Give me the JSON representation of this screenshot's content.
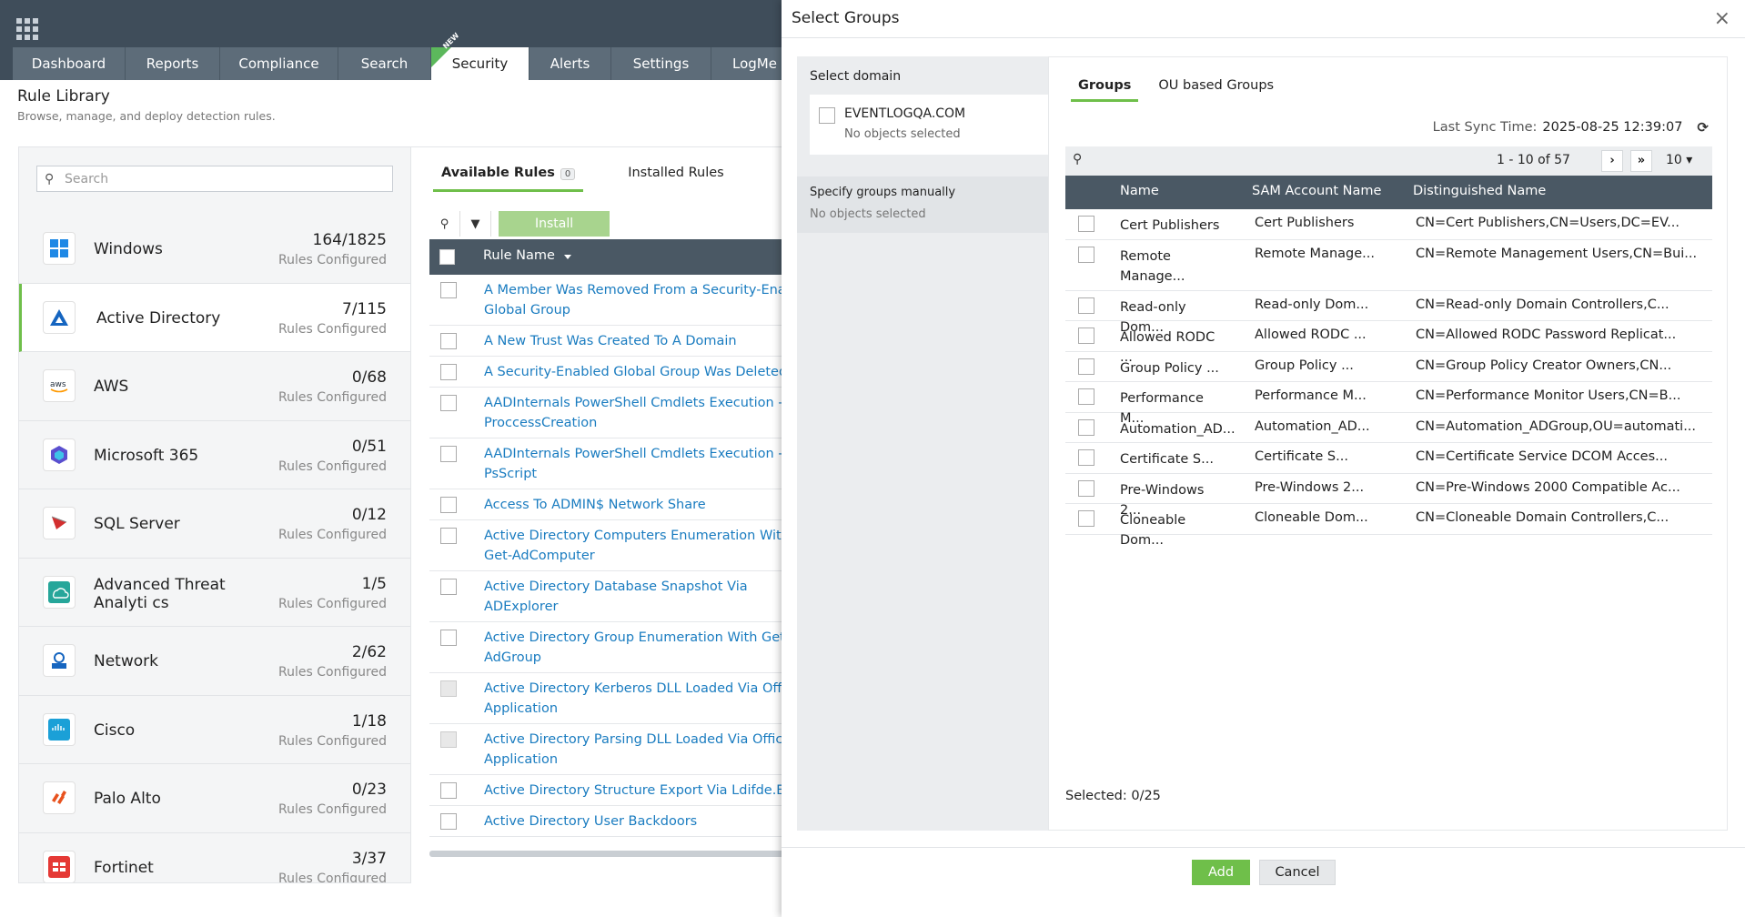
{
  "nav": {
    "tabs": [
      "Dashboard",
      "Reports",
      "Compliance",
      "Search",
      "Security",
      "Alerts",
      "Settings",
      "LogMe"
    ],
    "new_badge": "NEW"
  },
  "page": {
    "title": "Rule Library",
    "subtitle": "Browse, manage, and deploy detection rules."
  },
  "search": {
    "placeholder": "Search"
  },
  "categories": [
    {
      "name": "Windows",
      "count": "164/1825",
      "sub": "Rules Configured"
    },
    {
      "name": "Active Directory",
      "count": "7/115",
      "sub": "Rules Configured"
    },
    {
      "name": "AWS",
      "count": "0/68",
      "sub": "Rules Configured"
    },
    {
      "name": "Microsoft 365",
      "count": "0/51",
      "sub": "Rules Configured"
    },
    {
      "name": "SQL Server",
      "count": "0/12",
      "sub": "Rules Configured"
    },
    {
      "name": "Advanced Threat Analyti cs",
      "count": "1/5",
      "sub": "Rules Configured"
    },
    {
      "name": "Network",
      "count": "2/62",
      "sub": "Rules Configured"
    },
    {
      "name": "Cisco",
      "count": "1/18",
      "sub": "Rules Configured"
    },
    {
      "name": "Palo Alto",
      "count": "0/23",
      "sub": "Rules Configured"
    },
    {
      "name": "Fortinet",
      "count": "3/37",
      "sub": "Rules Configured"
    }
  ],
  "rules": {
    "tab_available": "Available Rules",
    "tab_available_count": "0",
    "tab_installed": "Installed Rules",
    "install_label": "Install",
    "column": "Rule Name",
    "rows": [
      {
        "l1": "A Member Was Removed From a Security-Enab",
        "l2": "Global Group"
      },
      {
        "l1": "A New Trust Was Created To A Domain",
        "l2": ""
      },
      {
        "l1": "A Security-Enabled Global Group Was Deleted",
        "l2": ""
      },
      {
        "l1": "AADInternals PowerShell Cmdlets Execution -",
        "l2": "ProccessCreation"
      },
      {
        "l1": "AADInternals PowerShell Cmdlets Execution -",
        "l2": "PsScript"
      },
      {
        "l1": "Access To ADMIN$ Network Share",
        "l2": ""
      },
      {
        "l1": "Active Directory Computers Enumeration With",
        "l2": "Get-AdComputer"
      },
      {
        "l1": "Active Directory Database Snapshot Via",
        "l2": "ADExplorer"
      },
      {
        "l1": "Active Directory Group Enumeration With Get-",
        "l2": "AdGroup"
      },
      {
        "l1": "Active Directory Kerberos DLL Loaded Via Office",
        "l2": "Application"
      },
      {
        "l1": "Active Directory Parsing DLL Loaded Via Office",
        "l2": "Application"
      },
      {
        "l1": "Active Directory Structure Export Via Ldifde.EXE",
        "l2": ""
      },
      {
        "l1": "Active Directory User Backdoors",
        "l2": ""
      }
    ]
  },
  "modal": {
    "title": "Select Groups",
    "close": "×",
    "domain_title": "Select domain",
    "domain_name": "EVENTLOGQA.COM",
    "domain_sub": "No objects selected",
    "manual_title": "Specify groups manually",
    "manual_sub": "No objects selected",
    "tab_groups": "Groups",
    "tab_ou": "OU based Groups",
    "sync_label": "Last Sync Time:",
    "sync_value": "2025-08-25 12:39:07",
    "pager": "1 - 10 of 57",
    "page_size": "10",
    "columns": [
      "Name",
      "SAM Account Name",
      "Distinguished Name"
    ],
    "rows": [
      {
        "name": "Cert Publishers",
        "name2": "",
        "sam": "Cert Publishers",
        "dn": "CN=Cert Publishers,CN=Users,DC=EV..."
      },
      {
        "name": "Remote",
        "name2": "Manage...",
        "sam": "Remote Manage...",
        "dn": "CN=Remote Management Users,CN=Bui..."
      },
      {
        "name": "Read-only Dom...",
        "name2": "",
        "sam": "Read-only Dom...",
        "dn": "CN=Read-only Domain Controllers,C..."
      },
      {
        "name": "Allowed RODC ...",
        "name2": "",
        "sam": "Allowed RODC ...",
        "dn": "CN=Allowed RODC Password Replicat..."
      },
      {
        "name": "Group Policy ...",
        "name2": "",
        "sam": "Group Policy ...",
        "dn": "CN=Group Policy Creator Owners,CN..."
      },
      {
        "name": "Performance M...",
        "name2": "",
        "sam": "Performance M...",
        "dn": "CN=Performance Monitor Users,CN=B..."
      },
      {
        "name": "Automation_AD...",
        "name2": "",
        "sam": "Automation_AD...",
        "dn": "CN=Automation_ADGroup,OU=automati..."
      },
      {
        "name": "Certificate S...",
        "name2": "",
        "sam": "Certificate S...",
        "dn": "CN=Certificate Service DCOM Acces..."
      },
      {
        "name": "Pre-Windows 2...",
        "name2": "",
        "sam": "Pre-Windows 2...",
        "dn": "CN=Pre-Windows 2000 Compatible Ac..."
      },
      {
        "name": "Cloneable Dom...",
        "name2": "",
        "sam": "Cloneable Dom...",
        "dn": "CN=Cloneable Domain Controllers,C..."
      }
    ],
    "selected": "Selected: 0/25",
    "add": "Add",
    "cancel": "Cancel"
  },
  "colors": {
    "accent": "#6fbf4a",
    "header": "#4a5864",
    "link": "#1a7cc0"
  }
}
